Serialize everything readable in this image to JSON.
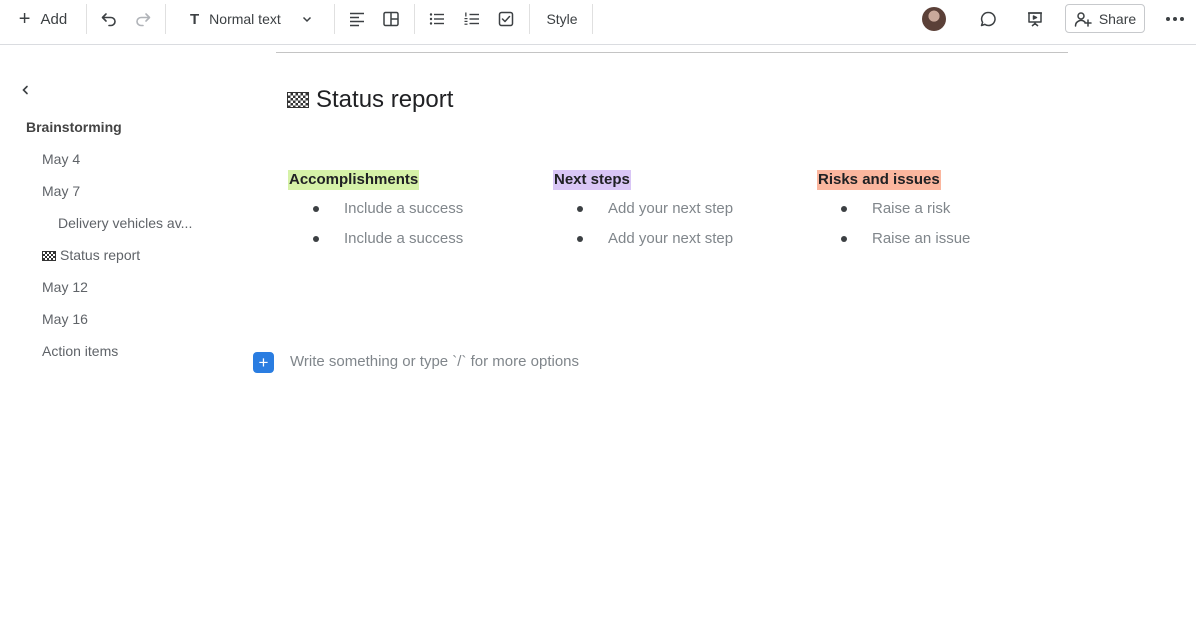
{
  "toolbar": {
    "add_label": "Add",
    "text_style": "Normal text",
    "text_style_icon": "T",
    "style_label": "Style",
    "share_label": "Share",
    "icons": [
      "undo-icon",
      "redo-icon",
      "align-left-icon",
      "layout-icon",
      "bulleted-list-icon",
      "numbered-list-icon",
      "checklist-icon",
      "comment-icon",
      "present-icon",
      "add-person-icon",
      "more-icon"
    ]
  },
  "sidebar": {
    "group": "Brainstorming",
    "items": [
      {
        "label": "May 4"
      },
      {
        "label": "May 7"
      },
      {
        "label": "Delivery vehicles av..."
      },
      {
        "label": "Status report"
      },
      {
        "label": "May 12"
      },
      {
        "label": "May 16"
      },
      {
        "label": "Action items"
      }
    ]
  },
  "document": {
    "title": "Status report",
    "columns": [
      {
        "heading": "Accomplishments",
        "highlight": "#d6f2a8",
        "bullets": [
          "Include a success",
          "Include a success"
        ]
      },
      {
        "heading": "Next steps",
        "highlight": "#d9c6f6",
        "bullets": [
          "Add your next step",
          "Add your next step"
        ]
      },
      {
        "heading": "Risks and issues",
        "highlight": "#fbb69e",
        "bullets": [
          "Raise a risk",
          "Raise an issue"
        ]
      }
    ],
    "placeholder": "Write something or type `/` for more options"
  },
  "colors": {
    "accent": "#2a7de1"
  }
}
